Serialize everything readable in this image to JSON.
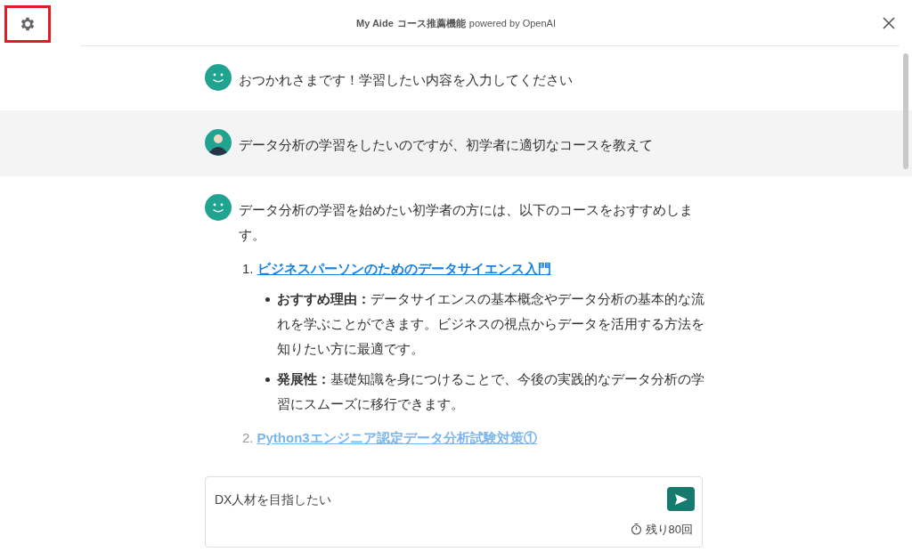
{
  "header": {
    "app_name": "My Aide",
    "feature": "コース推薦機能",
    "powered_by": "powered by OpenAI",
    "settings_highlighted": true
  },
  "messages": [
    {
      "kind": "bot",
      "text": "おつかれさまです！学習したい内容を入力してください"
    },
    {
      "kind": "user",
      "text": "データ分析の学習をしたいのですが、初学者に適切なコースを教えて"
    },
    {
      "kind": "bot",
      "text": "データ分析の学習を始めたい初学者の方には、以下のコースをおすすめします。",
      "courses": [
        {
          "number": "1.",
          "title": "ビジネスパーソンのためのデータサイエンス入門",
          "faded": false,
          "points": [
            "**おすすめ理由：**データサイエンスの基本概念やデータ分析の基本的な流れを学ぶことができます。ビジネスの視点からデータを活用する方法を知りたい方に最適です。",
            "**発展性：**基礎知識を身につけることで、今後の実践的なデータ分析の学習にスムーズに移行できます。"
          ]
        },
        {
          "number": "2.",
          "title": "Python3エンジニア認定データ分析試験対策①",
          "faded": true
        }
      ]
    }
  ],
  "composer": {
    "value": "DX人材を目指したい",
    "remaining": "残り80回"
  }
}
